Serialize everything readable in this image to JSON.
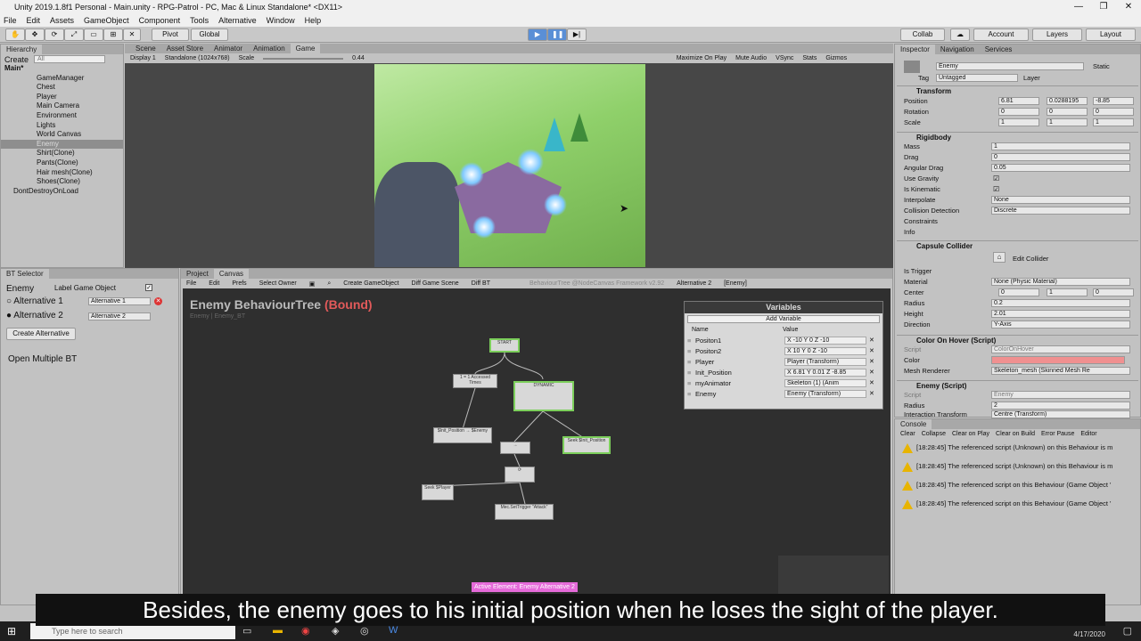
{
  "window": {
    "title": "Unity 2019.1.8f1 Personal - Main.unity - RPG-Patrol - PC, Mac & Linux Standalone* <DX11>"
  },
  "menu": [
    "File",
    "Edit",
    "Assets",
    "GameObject",
    "Component",
    "Tools",
    "Alternative",
    "Window",
    "Help"
  ],
  "toolbar": {
    "pivot": "Pivot",
    "global": "Global",
    "collab": "Collab",
    "account": "Account",
    "layers": "Layers",
    "layout": "Layout"
  },
  "hierarchy": {
    "tab": "Hierarchy",
    "create": "Create",
    "search_placeholder": "All",
    "items": [
      "Main*",
      "GameManager",
      "Chest",
      "Player",
      "Main Camera",
      "Environment",
      "Lights",
      "World Canvas",
      "Enemy",
      "Shirt(Clone)",
      "Pants(Clone)",
      "Hair mesh(Clone)",
      "Shoes(Clone)",
      "DontDestroyOnLoad"
    ]
  },
  "center_tabs": [
    "Scene",
    "Asset Store",
    "Animator",
    "Animation",
    "Game"
  ],
  "gamebar": {
    "display": "Display 1",
    "res": "Standalone (1024x768)",
    "scale": "Scale",
    "scale_val": "0.44",
    "max": "Maximize On Play",
    "mute": "Mute Audio",
    "vsync": "VSync",
    "stats": "Stats",
    "gizmos": "Gizmos"
  },
  "bt_selector": {
    "tab": "BT Selector",
    "name": "Enemy",
    "label": "Label Game Object",
    "alt1": "Alternative 1",
    "alt2": "Alternative 2",
    "alt1_val": "Alternative 1",
    "alt2_val": "Alternative 2",
    "create": "Create Alternative",
    "open": "Open Multiple BT"
  },
  "canvas": {
    "tabs": [
      "Project",
      "Canvas"
    ],
    "menu": [
      "File",
      "Edit",
      "Prefs",
      "Select Owner",
      "Create GameObject",
      "Diff Game Scene",
      "Diff BT"
    ],
    "right": "BehaviourTree @NodeCanvas Framework v2.92",
    "alt": "Alternative 2",
    "owner": "[Enemy]",
    "title": "Enemy BehaviourTree",
    "bound": "(Bound)",
    "sub": "Enemy | Enemy_BT",
    "active": "Active Element: Enemy Alternative 2",
    "nodes": {
      "start": "START",
      "dyn": "DYNAMIC",
      "n1": "1 = 1 Accessed Times",
      "n2": "$Init_Position → $Enemy",
      "n3": "Seek $Init_Position",
      "n4": "Seek $Player",
      "n5": "Mec.SetTrigger \"Attack\""
    }
  },
  "variables": {
    "title": "Variables",
    "add": "Add Variable",
    "col_name": "Name",
    "col_val": "Value",
    "rows": [
      {
        "name": "Positon1",
        "val": "X -10  Y 0  Z -10"
      },
      {
        "name": "Positon2",
        "val": "X 10  Y 0  Z -10"
      },
      {
        "name": "Player",
        "val": "Player (Transform)"
      },
      {
        "name": "Init_Position",
        "val": "X 6.81  Y 0.01  Z -8.85"
      },
      {
        "name": "myAnimator",
        "val": "Skeleton (1) (Anim"
      },
      {
        "name": "Enemy",
        "val": "Enemy (Transform)"
      }
    ]
  },
  "inspector": {
    "tabs": [
      "Inspector",
      "Navigation",
      "Services"
    ],
    "name": "Enemy",
    "static": "Static",
    "tag": "Tag",
    "tag_val": "Untagged",
    "layer": "Layer",
    "transform": "Transform",
    "position": "Position",
    "rotation": "Rotation",
    "scale": "Scale",
    "pos": [
      "6.81",
      "0.0288195",
      "-8.85"
    ],
    "rot": [
      "0",
      "0",
      "0"
    ],
    "scl": [
      "1",
      "1",
      "1"
    ],
    "rigidbody": "Rigidbody",
    "mass": "Mass",
    "mass_v": "1",
    "drag": "Drag",
    "drag_v": "0",
    "adrag": "Angular Drag",
    "adrag_v": "0.05",
    "gravity": "Use Gravity",
    "kinematic": "Is Kinematic",
    "interp": "Interpolate",
    "interp_v": "None",
    "coll": "Collision Detection",
    "coll_v": "Discrete",
    "constraints": "Constraints",
    "info": "Info",
    "capsule": "Capsule Collider",
    "edit": "Edit Collider",
    "trigger": "Is Trigger",
    "material": "Material",
    "material_v": "None (Physic Material)",
    "center": "Center",
    "center_v": [
      "0",
      "1",
      "0"
    ],
    "radius": "Radius",
    "radius_v": "0.2",
    "height": "Height",
    "height_v": "2.01",
    "direction": "Direction",
    "direction_v": "Y-Axis",
    "cohover": "Color On Hover (Script)",
    "script": "Script",
    "script_v": "ColorOnHover",
    "color": "Color",
    "mesh": "Mesh Renderer",
    "mesh_v": "Skeleton_mesh (Skinned Mesh Re",
    "enemy": "Enemy (Script)",
    "enemy_script": "Enemy",
    "eradius": "Radius",
    "eradius_v": "2",
    "itrans": "Interaction Transform",
    "itrans_v": "Centre (Transform)"
  },
  "console": {
    "tab": "Console",
    "buttons": [
      "Clear",
      "Collapse",
      "Clear on Play",
      "Clear on Build",
      "Error Pause",
      "Editor"
    ],
    "lines": [
      "[18:28:45] The referenced script (Unknown) on this Behaviour is m",
      "[18:28:45] The referenced script (Unknown) on this Behaviour is m",
      "[18:28:45] The referenced script on this Behaviour (Game Object '",
      "[18:28:45] The referenced script on this Behaviour (Game Object '"
    ]
  },
  "subtitle": "Besides, the enemy goes to his initial position when he loses the sight of the player.",
  "taskbar": {
    "search": "Type here to search",
    "date": "4/17/2020"
  }
}
